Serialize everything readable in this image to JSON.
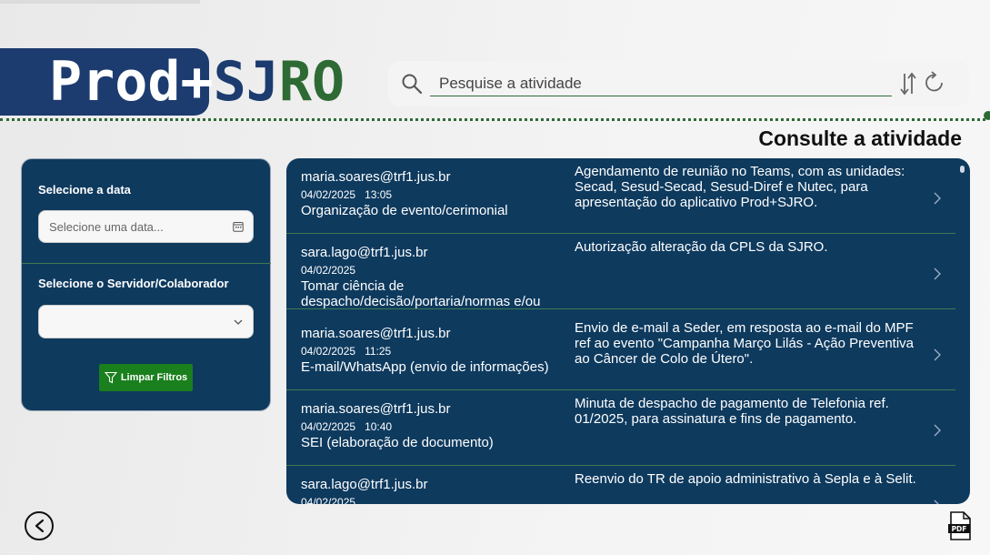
{
  "logo": {
    "prod": "Prod+",
    "sj": "SJ",
    "ro": "RO"
  },
  "search": {
    "placeholder": "Pesquise a atividade"
  },
  "page_title": "Consulte a atividade",
  "filters": {
    "date_label": "Selecione a data",
    "date_placeholder": "Selecione uma data...",
    "server_label": "Selecione o Servidor/Colaborador",
    "server_value": "",
    "clear_label": "Limpar Filtros"
  },
  "activities": [
    {
      "user": "maria.soares@trf1.jus.br",
      "date": "04/02/2025",
      "time": "13:05",
      "category": "Organização de evento/cerimonial",
      "description": "Agendamento de reunião no Teams, com as unidades: Secad, Sesud-Secad, Sesud-Diref e Nutec, para apresentação do aplicativo Prod+SJRO."
    },
    {
      "user": "sara.lago@trf1.jus.br",
      "date": "04/02/2025",
      "time": "",
      "category": "Tomar ciência de despacho/decisão/portaria/normas e/ou",
      "description": "Autorização alteração da CPLS da SJRO."
    },
    {
      "user": "maria.soares@trf1.jus.br",
      "date": "04/02/2025",
      "time": "11:25",
      "category": "E-mail/WhatsApp (envio de informações)",
      "description": "Envio de e-mail a Seder, em resposta ao e-mail do MPF ref ao evento \"Campanha Março Lilás - Ação Preventiva ao Câncer de Colo de Útero\"."
    },
    {
      "user": "maria.soares@trf1.jus.br",
      "date": "04/02/2025",
      "time": "10:40",
      "category": "SEI (elaboração de documento)",
      "description": "Minuta de despacho de pagamento de Telefonia ref. 01/2025, para assinatura e fins de pagamento."
    },
    {
      "user": "sara.lago@trf1.jus.br",
      "date": "04/02/2025",
      "time": "",
      "category": "",
      "description": "Reenvio do TR de apoio administrativo à Sepla e à Selit."
    }
  ],
  "colors": {
    "navy": "#0e3a5e",
    "logo_blue": "#1c3b6f",
    "green": "#2e6b34",
    "button_green": "#1a7f1d"
  },
  "icons": [
    "search-icon",
    "sort-icon",
    "refresh-icon",
    "calendar-icon",
    "chevron-down-icon",
    "filter-icon",
    "chevron-right-icon",
    "back-arrow-icon",
    "pdf-icon"
  ]
}
